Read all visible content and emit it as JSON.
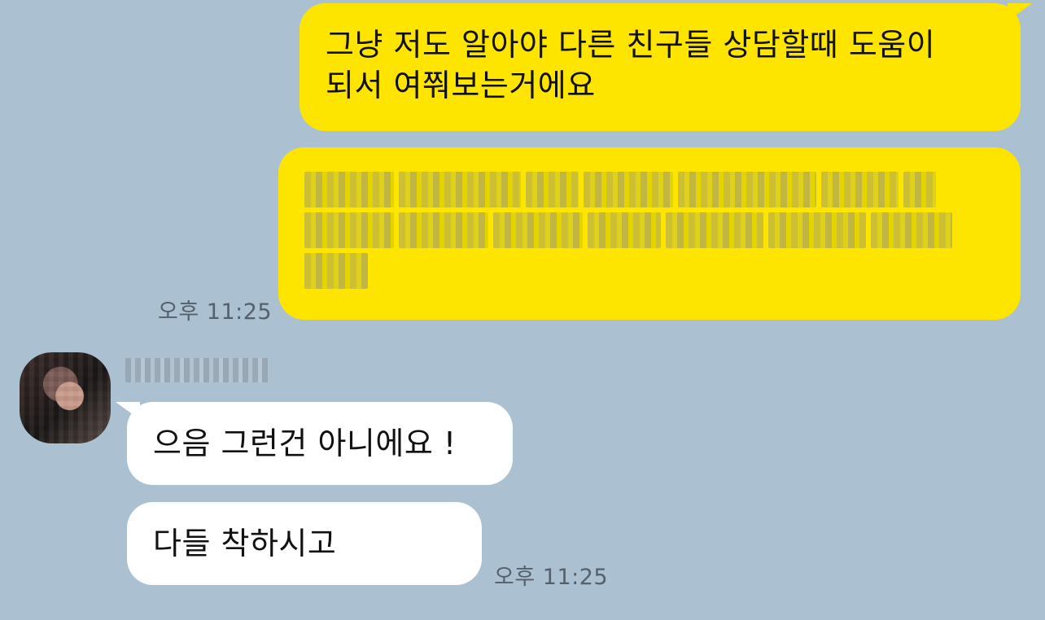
{
  "messages": {
    "sent_1": {
      "line1": "그냥 저도 알아야 다른 친구들 상담할때 도움이",
      "line2": "되서 여쭤보는거에요"
    },
    "sent_2_blurred": true,
    "sent_time": "오후 11:25",
    "recv_1": "으음 그런건 아니에요 !",
    "recv_2": "다들 착하시고",
    "recv_time": "오후 11:25"
  },
  "colors": {
    "background": "#abc1d1",
    "sent_bubble": "#fee500",
    "received_bubble": "#ffffff"
  }
}
